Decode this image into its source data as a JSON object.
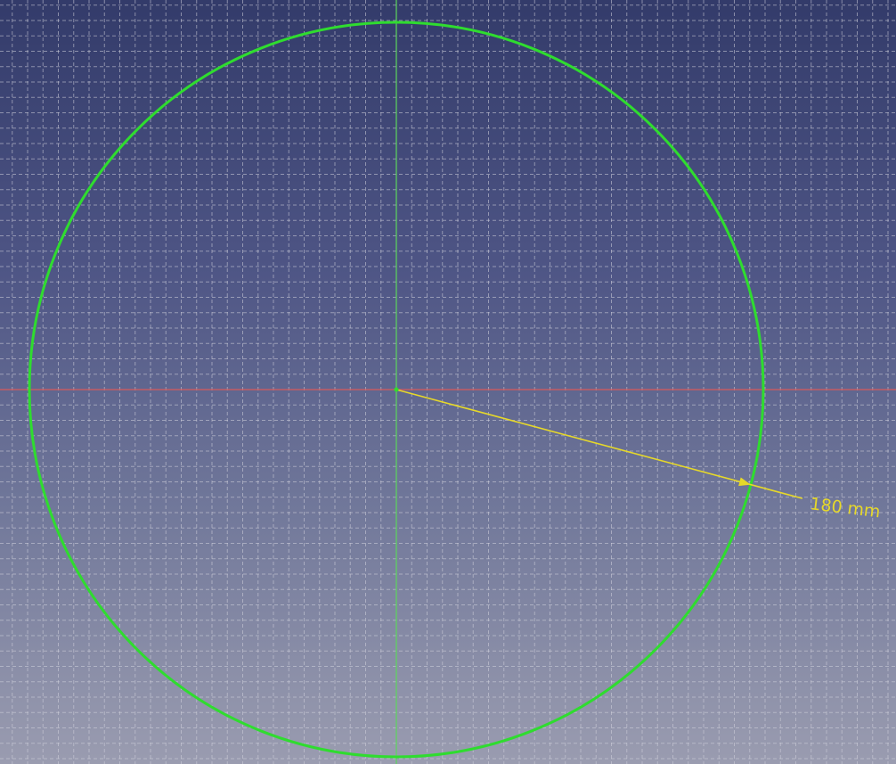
{
  "sketch": {
    "radius_dimension": {
      "label": "180 mm",
      "value": 180,
      "unit": "mm"
    },
    "geometry": {
      "circle": {
        "radius_mm": 180
      },
      "radius_angle_deg": -15
    },
    "colors": {
      "background_top": "#333b6a",
      "background_bottom": "#9a9cb0",
      "grid": "#d2d2dc",
      "circle": "#2fdc2f",
      "vertical_axis": "#5cd65c",
      "horizontal_axis": "#d85a5a",
      "dimension": "#e6d82a",
      "center_point": "#2fdc2f"
    }
  }
}
